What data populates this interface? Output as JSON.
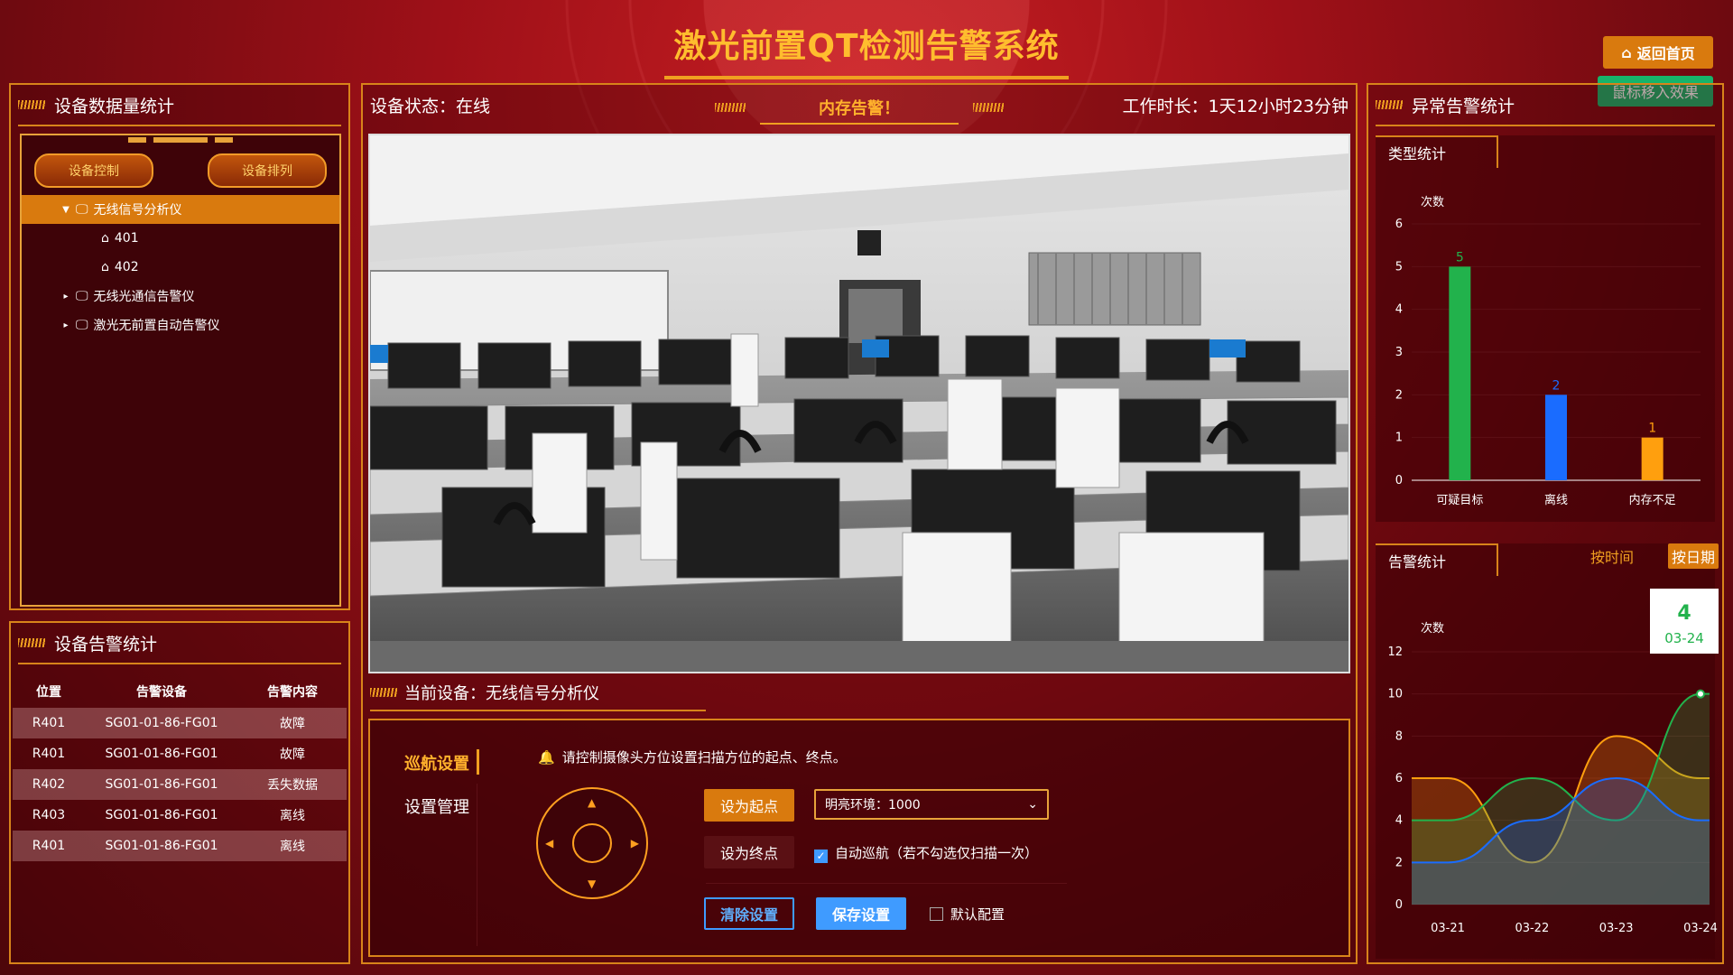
{
  "title": "激光前置QT检测告警系统",
  "home_button": "返回首页",
  "hover_tip": "鼠标移入效果",
  "left_top": {
    "heading": "设备数据量统计",
    "btn_control": "设备控制",
    "btn_arrange": "设备排列",
    "tree": [
      {
        "label": "无线信号分析仪",
        "expanded": true,
        "active": true
      },
      {
        "label": "401",
        "child": true
      },
      {
        "label": "402",
        "child": true
      },
      {
        "label": "无线光通信告警仪",
        "expanded": false
      },
      {
        "label": "激光无前置自动告警仪",
        "expanded": false
      }
    ]
  },
  "left_bottom": {
    "heading": "设备告警统计",
    "columns": [
      "位置",
      "告警设备",
      "告警内容"
    ],
    "rows": [
      [
        "R401",
        "SG01-01-86-FG01",
        "故障"
      ],
      [
        "R401",
        "SG01-01-86-FG01",
        "故障"
      ],
      [
        "R402",
        "SG01-01-86-FG01",
        "丢失数据"
      ],
      [
        "R403",
        "SG01-01-86-FG01",
        "离线"
      ],
      [
        "R401",
        "SG01-01-86-FG01",
        "离线"
      ]
    ]
  },
  "center": {
    "status": "设备状态：在线",
    "memory_alarm": "内存告警！",
    "work_time": "工作时长：1天12小时23分钟",
    "current_device": "当前设备：无线信号分析仪",
    "tab_cruise": "巡航设置",
    "tab_manage": "设置管理",
    "hint": "请控制摄像头方位设置扫描方位的起点、终点。",
    "btn_start": "设为起点",
    "btn_end": "设为终点",
    "select_value": "明亮环境：1000",
    "auto_cruise": "自动巡航（若不勾选仅扫描一次）",
    "btn_clear": "清除设置",
    "btn_save": "保存设置",
    "default_config": "默认配置"
  },
  "right": {
    "heading": "异常告警统计",
    "type_tab": "类型统计",
    "alarm_tab": "告警统计",
    "by_time": "按时间",
    "by_date": "按日期"
  },
  "chart_data": [
    {
      "type": "bar",
      "ylabel": "次数",
      "categories": [
        "可疑目标",
        "离线",
        "内存不足"
      ],
      "values": [
        5,
        2,
        1
      ],
      "colors": [
        "#22b24c",
        "#1a6cff",
        "#ff9f0e"
      ],
      "ylim": [
        0,
        6
      ],
      "yticks": [
        0,
        1,
        2,
        3,
        4,
        5,
        6
      ]
    },
    {
      "type": "area",
      "ylabel": "次数",
      "categories": [
        "03-21",
        "03-22",
        "03-23",
        "03-24"
      ],
      "ylim": [
        0,
        12
      ],
      "yticks": [
        0,
        2,
        4,
        6,
        8,
        10,
        12
      ],
      "series": [
        {
          "values": [
            6,
            2,
            8,
            6
          ],
          "color": "#ff9f0e"
        },
        {
          "values": [
            4,
            6,
            4,
            10
          ],
          "color": "#22b24c"
        },
        {
          "values": [
            2,
            4,
            6,
            4
          ],
          "color": "#1a6cff"
        }
      ],
      "tooltip": {
        "value": "4",
        "label": "03-24"
      }
    }
  ]
}
